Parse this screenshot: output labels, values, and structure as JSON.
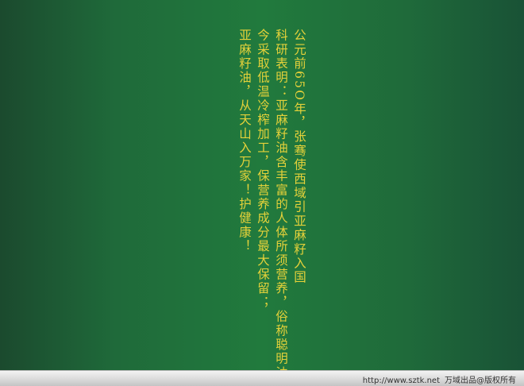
{
  "slide": {
    "background_color": "#217a3d",
    "text_color": "#e4d13a",
    "lines": [
      "公元前65O年，张骞使西域引亚麻籽入国",
      "科研表明：亚麻籽油含丰富的人体所须营养，俗称聪明油；",
      "今采取低温冷榨加工，保营养成分最大保留；",
      "亚麻籽油，从天山入万家！护健康！"
    ]
  },
  "footer": {
    "url": "http://www.sztk.net",
    "credit": "万域出品@版权所有"
  }
}
